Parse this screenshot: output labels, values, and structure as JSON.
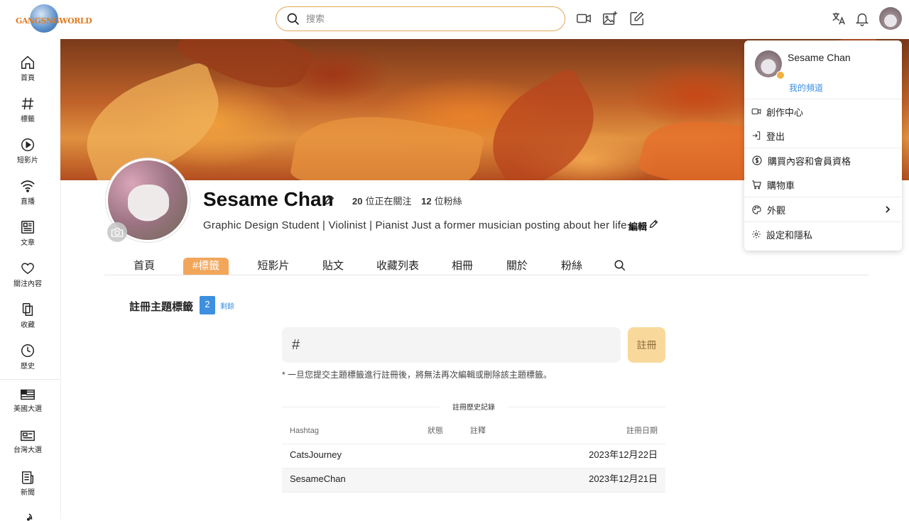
{
  "header": {
    "logo_text": "GANGSNGWORLD",
    "search_placeholder": "搜索"
  },
  "sidebar": {
    "items": [
      {
        "label": "首頁",
        "icon": "home-icon"
      },
      {
        "label": "標籤",
        "icon": "hashtag-icon"
      },
      {
        "label": "短影片",
        "icon": "play-circle-icon"
      },
      {
        "label": "直播",
        "icon": "wifi-icon"
      },
      {
        "label": "文章",
        "icon": "article-icon"
      },
      {
        "label": "關注內容",
        "icon": "heart-icon"
      },
      {
        "label": "收藏",
        "icon": "collection-icon"
      },
      {
        "label": "歷史",
        "icon": "clock-icon"
      },
      {
        "label": "美國大選",
        "icon": "flag-icon"
      },
      {
        "label": "台灣大選",
        "icon": "ballot-icon"
      },
      {
        "label": "新聞",
        "icon": "news-icon"
      }
    ]
  },
  "profile": {
    "name": "Sesame Chan",
    "following_count": "20",
    "following_label": "位正在關注",
    "followers_count": "12",
    "followers_label": "位粉絲",
    "bio": "Graphic Design Student | Violinist | Pianist Just a former musician posting about her life~",
    "edit_label": "編輯"
  },
  "tabs": [
    {
      "label": "首頁",
      "active": false
    },
    {
      "label": "#標籤",
      "active": true
    },
    {
      "label": "短影片",
      "active": false
    },
    {
      "label": "貼文",
      "active": false
    },
    {
      "label": "收藏列表",
      "active": false
    },
    {
      "label": "相冊",
      "active": false
    },
    {
      "label": "關於",
      "active": false
    },
    {
      "label": "粉絲",
      "active": false
    }
  ],
  "register": {
    "title": "註冊主題標籤",
    "remaining_count": "2",
    "remaining_label": "剩餘",
    "hash_sign": "#",
    "input_value": "",
    "button_label": "註冊",
    "warning": "* 一旦您提交主題標籤進行註冊後，將無法再次編輯或刪除該主題標籤。"
  },
  "history": {
    "title": "註冊歷史記錄",
    "columns": [
      "Hashtag",
      "狀態",
      "註釋",
      "註冊日期"
    ],
    "rows": [
      {
        "hashtag": "CatsJourney",
        "status": "",
        "note": "",
        "date": "2023年12月22日"
      },
      {
        "hashtag": "SesameChan",
        "status": "",
        "note": "",
        "date": "2023年12月21日"
      }
    ]
  },
  "dropdown": {
    "user_name": "Sesame Chan",
    "my_channel": "我的頻道",
    "items": [
      {
        "label": "創作中心",
        "icon": "video-camera-icon"
      },
      {
        "label": "登出",
        "icon": "logout-icon"
      },
      {
        "label": "購買內容和會員資格",
        "icon": "dollar-circle-icon"
      },
      {
        "label": "購物車",
        "icon": "cart-icon"
      },
      {
        "label": "外觀",
        "icon": "palette-icon"
      },
      {
        "label": "設定和隱私",
        "icon": "settings-icon"
      }
    ]
  },
  "colors": {
    "accent": "#f2a65a",
    "link": "#3d8fe0",
    "register_button": "#f9d99b"
  }
}
